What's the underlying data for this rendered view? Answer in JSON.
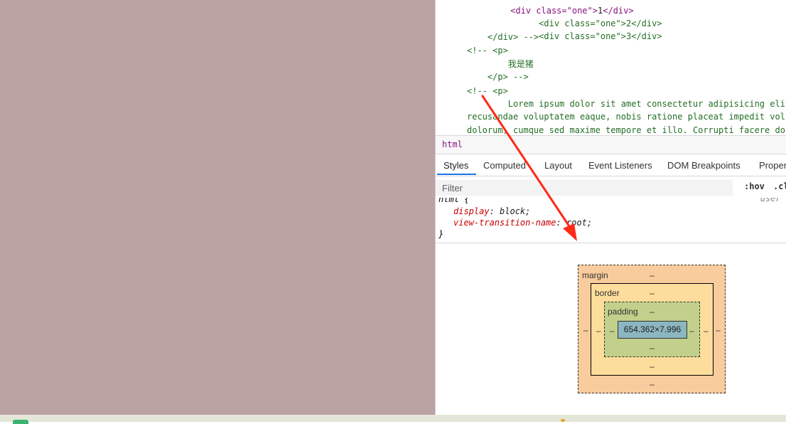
{
  "elements_code": {
    "line0": {
      "indent": "        ",
      "open": "<div class=\"one\">",
      "text": "1",
      "close": "</div>"
    },
    "line1": {
      "indent": "        ",
      "open": "<div class=\"one\">",
      "text": "2",
      "close": "</div>"
    },
    "line2": {
      "indent": "        ",
      "open": "<div class=\"one\">",
      "text": "3",
      "close": "</div>"
    },
    "line3": "    </div> -->",
    "line4": "<!-- <p>",
    "line5": "        我是猪",
    "line6": "    </p> -->",
    "line7": "<!-- <p>",
    "line8": "        Lorem ipsum dolor sit amet consectetur adipisicing elit.",
    "line9": "recusandae voluptatem eaque, nobis ratione placeat impedit vol",
    "line10": "dolorum, cumque sed maxime tempore et illo. Corrupti facere do"
  },
  "breadcrumb": {
    "item": "html"
  },
  "tabs": [
    "Styles",
    "Computed",
    "Layout",
    "Event Listeners",
    "DOM Breakpoints",
    "Proper"
  ],
  "filter": {
    "placeholder": "Filter",
    "hov": ":hov",
    "cls": ".cl"
  },
  "css_rule": {
    "selector": "html {",
    "source": "user a",
    "prop1_name": "display",
    "prop1_value": "block;",
    "prop2_name": "view-transition-name",
    "prop2_value": "root;",
    "close": "}"
  },
  "box_model": {
    "margin_label": "margin",
    "border_label": "border",
    "padding_label": "padding",
    "content_size": "654.362×7.996",
    "dash": "–"
  },
  "colors": {
    "page_background": "#bba2a3",
    "margin": "#f9cc9d",
    "border": "#fddd9b",
    "padding": "#c3d08b",
    "content": "#8cb6c0",
    "annotation_arrow": "#ff2a1a",
    "active_tab": "#1a73e8"
  },
  "icons": {
    "taskbar_app": "green-app-icon"
  }
}
